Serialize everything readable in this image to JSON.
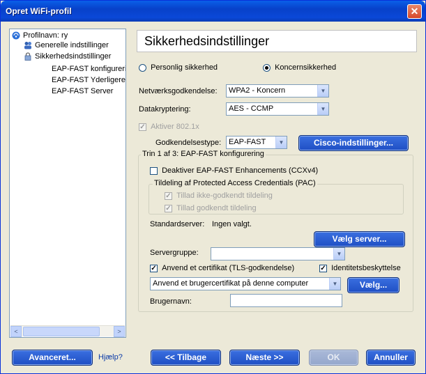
{
  "window": {
    "title": "Opret WiFi-profil",
    "close_symbol": "✕"
  },
  "tree": {
    "items": [
      {
        "label": "Profilnavn: ry",
        "icon": "wifi-icon"
      },
      {
        "label": "Generelle indstillinger",
        "icon": "users-icon"
      },
      {
        "label": "Sikkerhedsindstillinger",
        "icon": "lock-icon"
      },
      {
        "label": "EAP-FAST konfigurering"
      },
      {
        "label": "EAP-FAST Yderligere i"
      },
      {
        "label": "EAP-FAST Server"
      }
    ]
  },
  "header": {
    "title": "Sikkerhedsindstillinger"
  },
  "security": {
    "personal_label": "Personlig sikkerhed",
    "enterprise_label": "Koncernsikkerhed",
    "selected": "enterprise",
    "network_auth_label": "Netværksgodkendelse:",
    "network_auth_value": "WPA2 - Koncern",
    "encryption_label": "Datakryptering:",
    "encryption_value": "AES - CCMP",
    "enable_8021x_label": "Aktiver 802.1x",
    "auth_type_label": "Godkendelsestype:",
    "auth_type_value": "EAP-FAST",
    "cisco_button": "Cisco-indstillinger..."
  },
  "step": {
    "group_label": "Trin 1 af 3: EAP-FAST konfigurering",
    "disable_enhancements_label": "Deaktiver EAP-FAST Enhancements (CCXv4)",
    "pac_group_label": "Tildeling af Protected Access Credentials (PAC)",
    "allow_unauth_label": "Tillad ikke-godkendt tildeling",
    "allow_auth_label": "Tillad godkendt tildeling",
    "default_server_label": "Standardserver:",
    "default_server_value": "Ingen valgt.",
    "select_server_button": "Vælg server...",
    "server_group_label": "Servergruppe:",
    "server_group_value": "",
    "use_cert_label": "Anvend et certifikat (TLS-godkendelse)",
    "identity_protection_label": "Identitetsbeskyttelse",
    "cert_select_value": "Anvend et brugercertifikat på denne computer",
    "choose_button": "Vælg...",
    "username_label": "Brugernavn:",
    "username_value": ""
  },
  "footer": {
    "advanced_button": "Avanceret...",
    "help_link": "Hjælp?",
    "back_button": "<< Tilbage",
    "next_button": "Næste >>",
    "ok_button": "OK",
    "cancel_button": "Annuller"
  }
}
